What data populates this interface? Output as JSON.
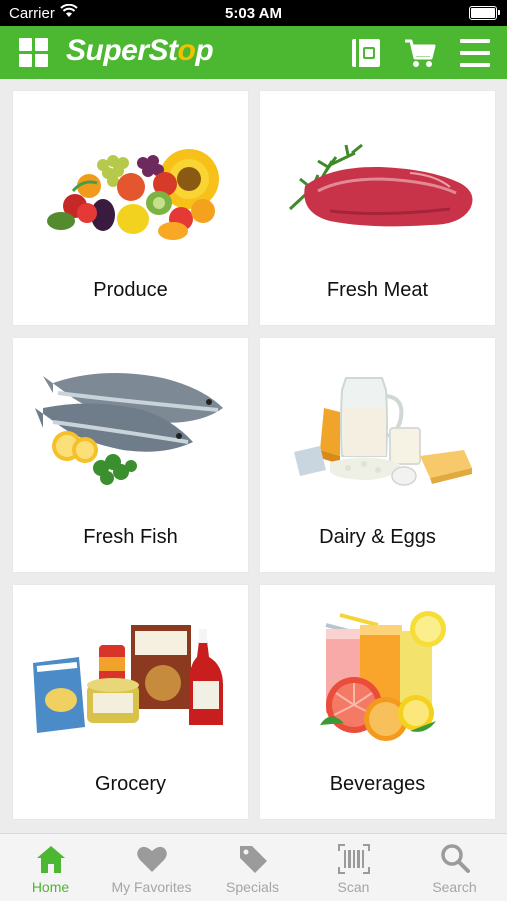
{
  "status_bar": {
    "carrier": "Carrier",
    "time": "5:03 AM"
  },
  "header": {
    "brand_prefix": "SuperSt",
    "brand_highlight": "o",
    "brand_suffix": "p",
    "brand_color": "#4cb731"
  },
  "categories": [
    {
      "label": "Produce"
    },
    {
      "label": "Fresh Meat"
    },
    {
      "label": "Fresh Fish"
    },
    {
      "label": "Dairy & Eggs"
    },
    {
      "label": "Grocery"
    },
    {
      "label": "Beverages"
    }
  ],
  "tabs": [
    {
      "label": "Home",
      "icon": "home-icon",
      "active": true
    },
    {
      "label": "My Favorites",
      "icon": "heart-icon",
      "active": false
    },
    {
      "label": "Specials",
      "icon": "tag-icon",
      "active": false
    },
    {
      "label": "Scan",
      "icon": "barcode-icon",
      "active": false
    },
    {
      "label": "Search",
      "icon": "search-icon",
      "active": false
    }
  ]
}
